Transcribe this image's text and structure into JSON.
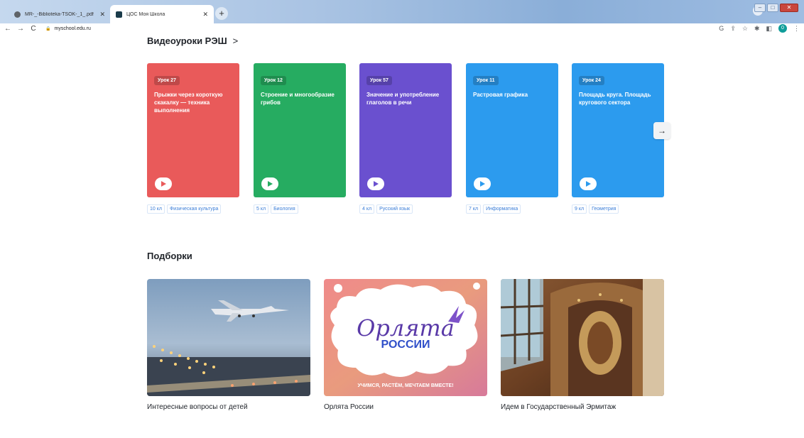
{
  "browser": {
    "tabs": [
      {
        "title": "MR-_-Biblioteka-TSOK-_1_.pdf",
        "close": "✕"
      },
      {
        "title": "ЦОС Моя Школа",
        "close": "✕"
      }
    ],
    "new_tab": "+",
    "url": "myschool.edu.ru",
    "nav": {
      "back": "←",
      "forward": "→",
      "reload": "C"
    },
    "toolbar_icons": [
      "G",
      "⇪",
      "☆",
      "✱",
      "◧"
    ],
    "profile_initial": "0"
  },
  "videos": {
    "title": "Видеоуроки РЭШ",
    "chevron": ">",
    "next_arrow": "→",
    "cards": [
      {
        "badge": "Урок 27",
        "title": "Прыжки через короткую скакалку — техника выполнения",
        "color": "#e95a5a",
        "grade": "10 кл",
        "subject": "Физическая культура"
      },
      {
        "badge": "Урок 12",
        "title": "Строение и многообразие грибов",
        "color": "#26ac61",
        "grade": "5 кл",
        "subject": "Биология"
      },
      {
        "badge": "Урок 57",
        "title": "Значение и употребление глаголов в речи",
        "color": "#6a50cf",
        "grade": "4 кл",
        "subject": "Русский язык"
      },
      {
        "badge": "Урок 11",
        "title": "Растровая графика",
        "color": "#2c9bee",
        "grade": "7 кл",
        "subject": "Информатика"
      },
      {
        "badge": "Урок 24",
        "title": "Площадь круга. Площадь кругового сектора",
        "color": "#2c9bee",
        "grade": "9 кл",
        "subject": "Геометрия"
      }
    ]
  },
  "collections": {
    "title": "Подборки",
    "items": [
      {
        "caption": "Интересные вопросы от детей"
      },
      {
        "caption": "Орлята России",
        "logo_text_1": "Орлята",
        "logo_text_2": "России",
        "slogan": "УЧИМСЯ, РАСТЁМ, МЕЧТАЕМ ВМЕСТЕ!"
      },
      {
        "caption": "Идем в Государственный Эрмитаж"
      }
    ]
  }
}
